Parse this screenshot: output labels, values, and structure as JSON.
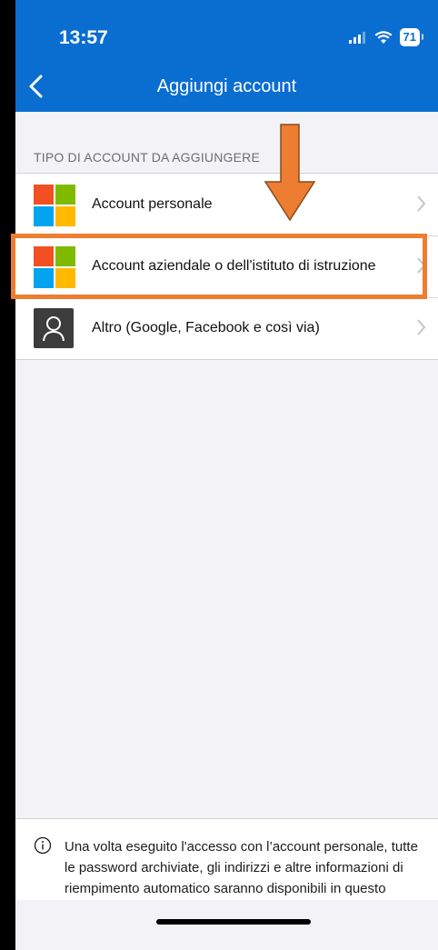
{
  "status_bar": {
    "time": "13:57",
    "battery": "71",
    "signal_icon": "signal-icon",
    "wifi_icon": "wifi-icon"
  },
  "nav": {
    "title": "Aggiungi account",
    "back_icon": "chevron-left-icon"
  },
  "section": {
    "header": "TIPO DI ACCOUNT DA AGGIUNGERE"
  },
  "accounts": [
    {
      "label": "Account personale",
      "icon": "microsoft-logo-icon"
    },
    {
      "label": "Account aziendale o dell'istituto di istruzione",
      "icon": "microsoft-logo-icon"
    },
    {
      "label": "Altro (Google, Facebook e così via)",
      "icon": "person-icon"
    }
  ],
  "footer": {
    "info_text": "Una volta eseguito l'accesso con l’account personale, tutte le password archiviate, gli indirizzi e altre informazioni di riempimento automatico saranno disponibili in questo dispositivo."
  },
  "colors": {
    "header_blue": "#0a6ed1",
    "highlight_orange": "#ed7d31",
    "ms_red": "#f25022",
    "ms_green": "#7fba00",
    "ms_blue": "#00a4ef",
    "ms_yellow": "#ffb900"
  }
}
